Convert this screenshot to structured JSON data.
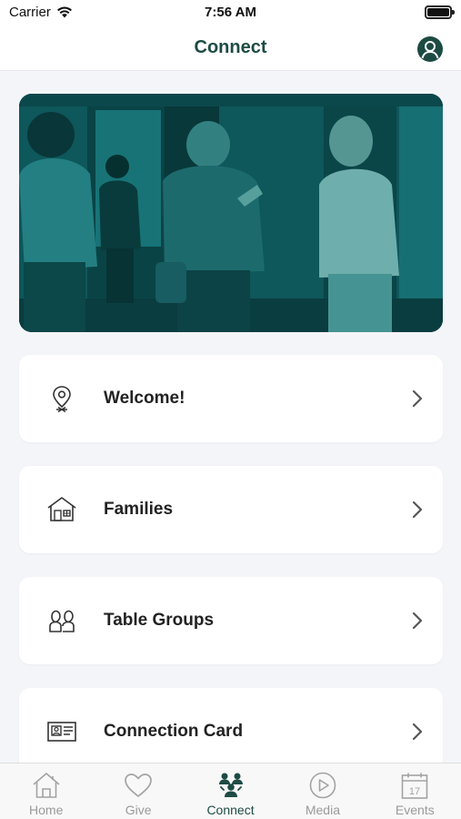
{
  "status_bar": {
    "carrier": "Carrier",
    "time": "7:56 AM"
  },
  "nav": {
    "title": "Connect",
    "profile_icon": "person-circle-icon"
  },
  "colors": {
    "accent": "#1d4b44",
    "hero_tint": "#0e4f52",
    "tab_inactive": "#9a9a9a"
  },
  "menu": [
    {
      "label": "Welcome!",
      "icon": "location-pin-icon"
    },
    {
      "label": "Families",
      "icon": "house-icon"
    },
    {
      "label": "Table Groups",
      "icon": "people-icon"
    },
    {
      "label": "Connection Card",
      "icon": "id-card-icon"
    }
  ],
  "tabs": [
    {
      "label": "Home",
      "icon": "home-icon",
      "active": false
    },
    {
      "label": "Give",
      "icon": "heart-icon",
      "active": false
    },
    {
      "label": "Connect",
      "icon": "group-icon",
      "active": true
    },
    {
      "label": "Media",
      "icon": "play-circle-icon",
      "active": false
    },
    {
      "label": "Events",
      "icon": "calendar-icon",
      "active": false,
      "badge": "17"
    }
  ]
}
